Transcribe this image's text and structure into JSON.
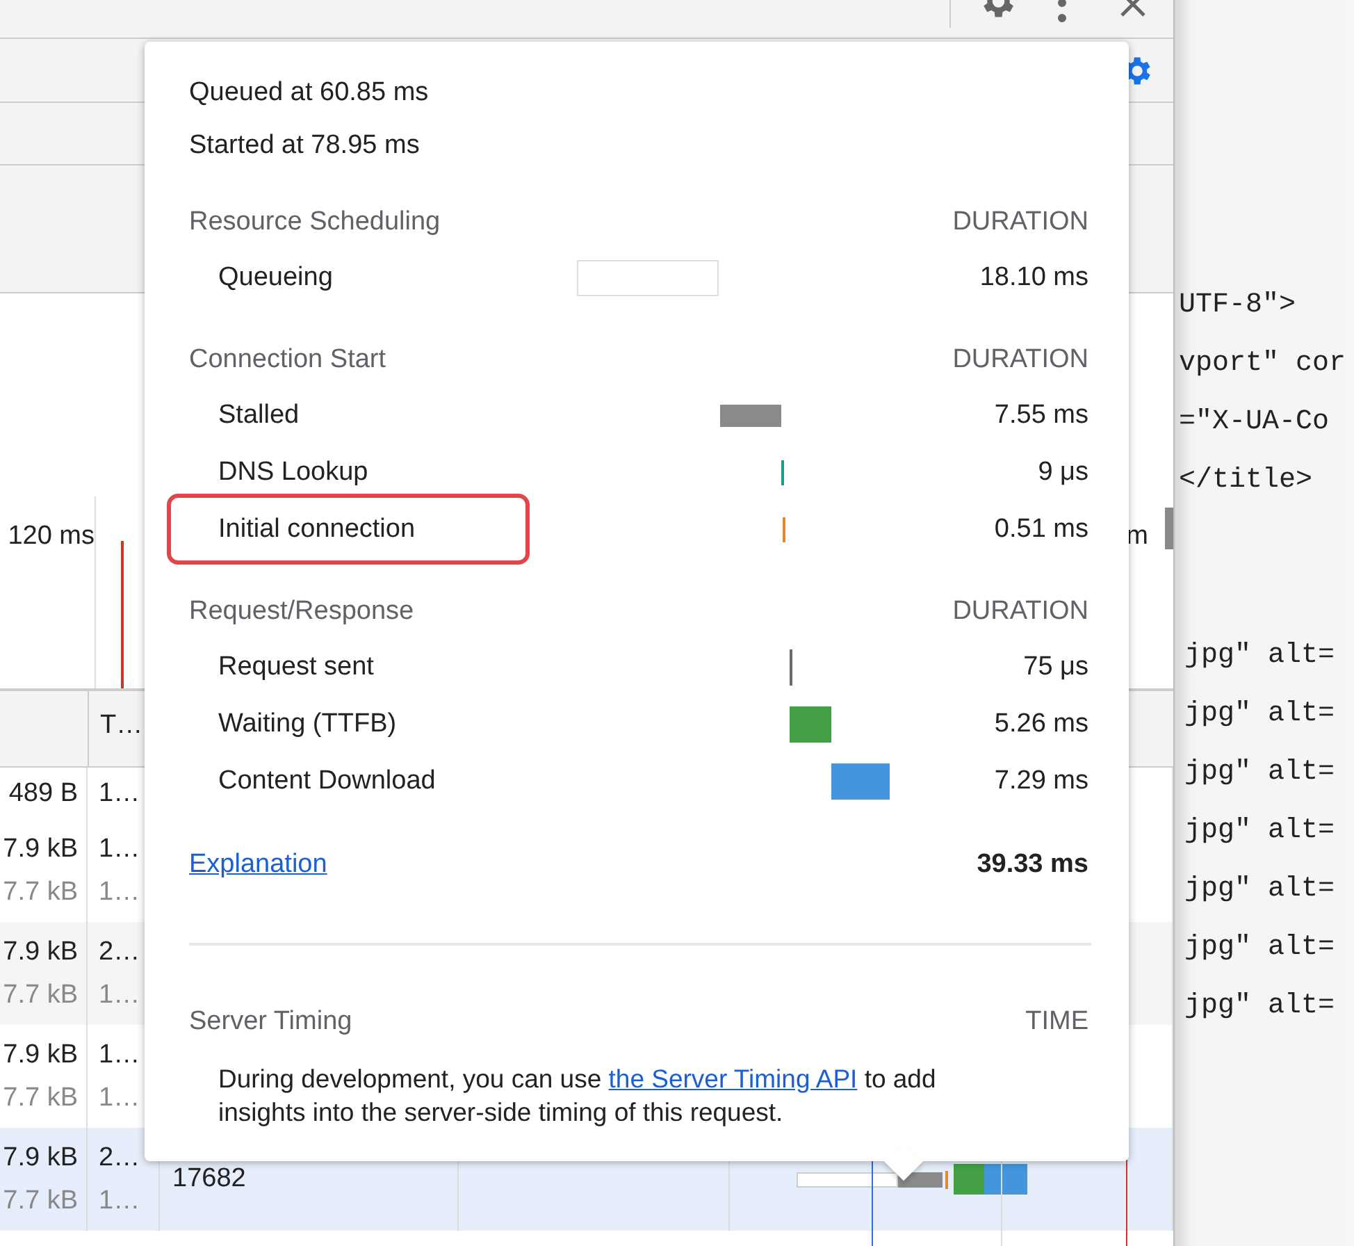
{
  "overview": {
    "tick_label": "120 ms",
    "tick_label_right": "m"
  },
  "table": {
    "header": {
      "column_2": "T…"
    },
    "rows": [
      {
        "size": [
          "489 B"
        ],
        "column_2": [
          "1…"
        ],
        "selected": false
      },
      {
        "size": [
          "7.9 kB",
          "7.7 kB"
        ],
        "column_2": [
          "1…",
          "1…"
        ],
        "selected": false
      },
      {
        "size": [
          "7.9 kB",
          "7.7 kB"
        ],
        "column_2": [
          "2…",
          "1…"
        ],
        "selected": false
      },
      {
        "size": [
          "7.9 kB",
          "7.7 kB"
        ],
        "column_2": [
          "1…",
          "1…"
        ],
        "selected": false
      },
      {
        "size": [
          "7.9 kB",
          "7.7 kB"
        ],
        "column_2": [
          "2…",
          "1…"
        ],
        "column_3": "17682",
        "selected": true
      }
    ]
  },
  "timing": {
    "queued": "Queued at 60.85 ms",
    "started": "Started at 78.95 ms",
    "sections": [
      {
        "title": "Resource Scheduling",
        "column": "DURATION",
        "rows": [
          {
            "label": "Queueing",
            "kind": "queueing",
            "value": "18.10 ms",
            "highlighted": false
          }
        ]
      },
      {
        "title": "Connection Start",
        "column": "DURATION",
        "rows": [
          {
            "label": "Stalled",
            "kind": "stalled",
            "value": "7.55 ms",
            "highlighted": false
          },
          {
            "label": "DNS Lookup",
            "kind": "dns",
            "value": "9 μs",
            "highlighted": false
          },
          {
            "label": "Initial connection",
            "kind": "connect",
            "value": "0.51 ms",
            "highlighted": true
          }
        ]
      },
      {
        "title": "Request/Response",
        "column": "DURATION",
        "rows": [
          {
            "label": "Request sent",
            "kind": "send",
            "value": "75 μs",
            "highlighted": false
          },
          {
            "label": "Waiting (TTFB)",
            "kind": "wait",
            "value": "5.26 ms",
            "highlighted": false
          },
          {
            "label": "Content Download",
            "kind": "download",
            "value": "7.29 ms",
            "highlighted": false
          }
        ]
      }
    ],
    "explanation": "Explanation",
    "total": "39.33 ms",
    "server_timing": {
      "title": "Server Timing",
      "column": "TIME",
      "text_before": "During development, you can use ",
      "link": "the Server Timing API",
      "text_after": " to add insights into the server-side timing of this request."
    }
  },
  "code": {
    "head_lines": [
      "UTF-8\">",
      "vport\" cor",
      "=\"X-UA-Co",
      "</title>"
    ],
    "body_lines": [
      "jpg\" alt=",
      "jpg\" alt=",
      "jpg\" alt=",
      "jpg\" alt=",
      "jpg\" alt=",
      "jpg\" alt=",
      "jpg\" alt="
    ]
  }
}
